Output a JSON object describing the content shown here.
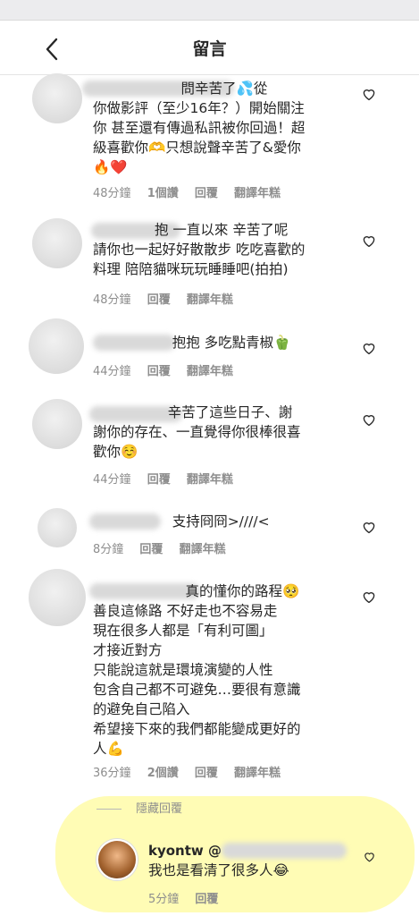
{
  "header": {
    "title": "留言"
  },
  "comments": [
    {
      "text": "                    問辛苦了💦從\n你做影評（至少16年？）開始關注\n你 甚至還有傳過私訊被你回過！超\n級喜歡你🫶只想說聲辛苦了&愛你\n🔥❤️",
      "time": "48分鐘",
      "likes": "1個讚",
      "reply": "回覆",
      "translate": "翻譯年糕"
    },
    {
      "text": "              抱 一直以來 辛苦了呢\n請你也一起好好散散步 吃吃喜歡的\n料理 陪陪貓咪玩玩睡睡吧(拍拍)",
      "time": "48分鐘",
      "reply": "回覆",
      "translate": "翻譯年糕"
    },
    {
      "text": "                  抱抱 多吃點青椒🫑",
      "time": "44分鐘",
      "reply": "回覆",
      "translate": "翻譯年糕"
    },
    {
      "text": "                 辛苦了這些日子、謝\n謝你的存在、一直覺得你很棒很喜\n歡你☺️",
      "time": "44分鐘",
      "reply": "回覆",
      "translate": "翻譯年糕"
    },
    {
      "text": "                  支持冏冏>////<",
      "time": "8分鐘",
      "reply": "回覆",
      "translate": "翻譯年糕"
    },
    {
      "text": "                     真的懂你的路程🥺\n善良這條路 不好走也不容易走\n現在很多人都是「有利可圖」\n才接近對方\n只能說這就是環境演變的人性\n包含自己都不可避免…要很有意識\n的避免自己陷入\n希望接下來的我們都能變成更好的\n人💪",
      "time": "36分鐘",
      "likes": "2個讚",
      "reply": "回覆",
      "translate": "翻譯年糕"
    }
  ],
  "hidden_replies_label": "隱藏回覆",
  "reply": {
    "username": "kyontw @",
    "text": "我也是看清了很多人😂",
    "time": "5分鐘",
    "reply_label": "回覆"
  },
  "colors": {
    "highlight": "#fff97a",
    "meta": "#8e8e8e",
    "text": "#262626"
  },
  "icons": {
    "back": "chevron-left-icon",
    "like": "heart-outline-icon"
  }
}
